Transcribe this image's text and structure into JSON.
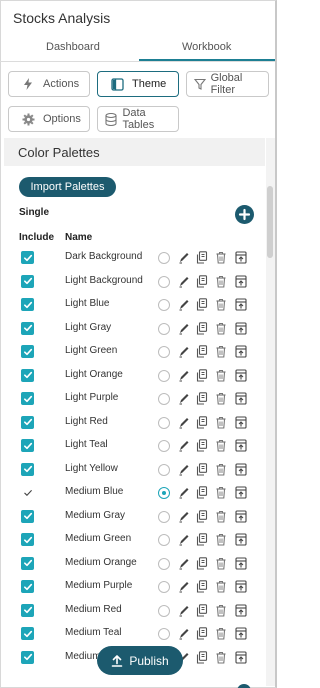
{
  "app": {
    "title": "Stocks Analysis"
  },
  "view_tabs": [
    {
      "label": "Dashboard"
    },
    {
      "label": "Workbook"
    }
  ],
  "toolbar": {
    "actions_label": "Actions",
    "theme_label": "Theme",
    "global_filter_label": "Global Filter",
    "options_label": "Options",
    "data_tables_label": "Data Tables"
  },
  "section": {
    "title": "Color Palettes"
  },
  "import_label": "Import Palettes",
  "group_label": "Single",
  "columns": {
    "include": "Include",
    "name": "Name"
  },
  "palettes": [
    {
      "name": "Dark Background",
      "included": true,
      "selected": false
    },
    {
      "name": "Light Background",
      "included": true,
      "selected": false
    },
    {
      "name": "Light Blue",
      "included": true,
      "selected": false
    },
    {
      "name": "Light Gray",
      "included": true,
      "selected": false
    },
    {
      "name": "Light Green",
      "included": true,
      "selected": false
    },
    {
      "name": "Light Orange",
      "included": true,
      "selected": false
    },
    {
      "name": "Light Purple",
      "included": true,
      "selected": false
    },
    {
      "name": "Light Red",
      "included": true,
      "selected": false
    },
    {
      "name": "Light Teal",
      "included": true,
      "selected": false
    },
    {
      "name": "Light Yellow",
      "included": true,
      "selected": false
    },
    {
      "name": "Medium Blue",
      "included": true,
      "selected": true
    },
    {
      "name": "Medium Gray",
      "included": true,
      "selected": false
    },
    {
      "name": "Medium Green",
      "included": true,
      "selected": false
    },
    {
      "name": "Medium Orange",
      "included": true,
      "selected": false
    },
    {
      "name": "Medium Purple",
      "included": true,
      "selected": false
    },
    {
      "name": "Medium Red",
      "included": true,
      "selected": false
    },
    {
      "name": "Medium Teal",
      "included": true,
      "selected": false
    },
    {
      "name": "Medium Yellow",
      "included": true,
      "selected": false
    }
  ],
  "publish_label": "Publish",
  "colors": {
    "accent": "#1da5b8",
    "primary_button": "#1c5a6e",
    "tab_underline": "#1d7f93"
  },
  "icons": {
    "actions": "lightning-icon",
    "theme": "theme-icon",
    "global_filter": "funnel-icon",
    "options": "gear-icon",
    "data_tables": "database-icon",
    "row_actions": [
      "edit-icon",
      "copy-icon",
      "delete-icon",
      "export-icon"
    ],
    "publish": "upload-icon",
    "add": "plus-icon"
  }
}
